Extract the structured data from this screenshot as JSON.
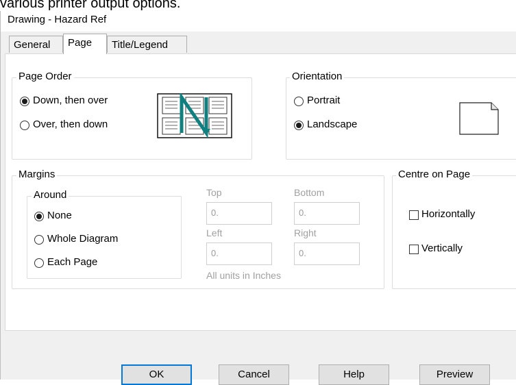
{
  "page": {
    "caption": "various printer output options."
  },
  "window": {
    "title": "Drawing - Hazard Ref"
  },
  "tabs": [
    {
      "label": "General",
      "active": false
    },
    {
      "label": "Page",
      "active": true
    },
    {
      "label": "Title/Legend",
      "active": false
    }
  ],
  "page_order": {
    "legend": "Page Order",
    "options": [
      {
        "label": "Down, then over",
        "selected": true
      },
      {
        "label": "Over, then down",
        "selected": false
      }
    ],
    "preview_icon": "page-order-grid-icon"
  },
  "orientation": {
    "legend": "Orientation",
    "options": [
      {
        "label": "Portrait",
        "selected": false
      },
      {
        "label": "Landscape",
        "selected": true
      }
    ],
    "preview_icon": "page-icon"
  },
  "margins": {
    "legend": "Margins",
    "around": {
      "legend": "Around",
      "options": [
        {
          "label": "None",
          "selected": true
        },
        {
          "label": "Whole Diagram",
          "selected": false
        },
        {
          "label": "Each Page",
          "selected": false
        }
      ]
    },
    "fields": {
      "top_label": "Top",
      "top_value": "0.",
      "bottom_label": "Bottom",
      "bottom_value": "0.",
      "left_label": "Left",
      "left_value": "0.",
      "right_label": "Right",
      "right_value": "0."
    },
    "units_note": "All units in Inches"
  },
  "centre_on_page": {
    "legend": "Centre on Page",
    "options": [
      {
        "label": "Horizontally",
        "checked": false
      },
      {
        "label": "Vertically",
        "checked": false
      }
    ]
  },
  "buttons": {
    "ok": "OK",
    "cancel": "Cancel",
    "help": "Help",
    "preview": "Preview"
  },
  "colors": {
    "accent": "#0078d7",
    "arrow": "#0f7f80",
    "dialog_bg": "#f0f0f0"
  }
}
